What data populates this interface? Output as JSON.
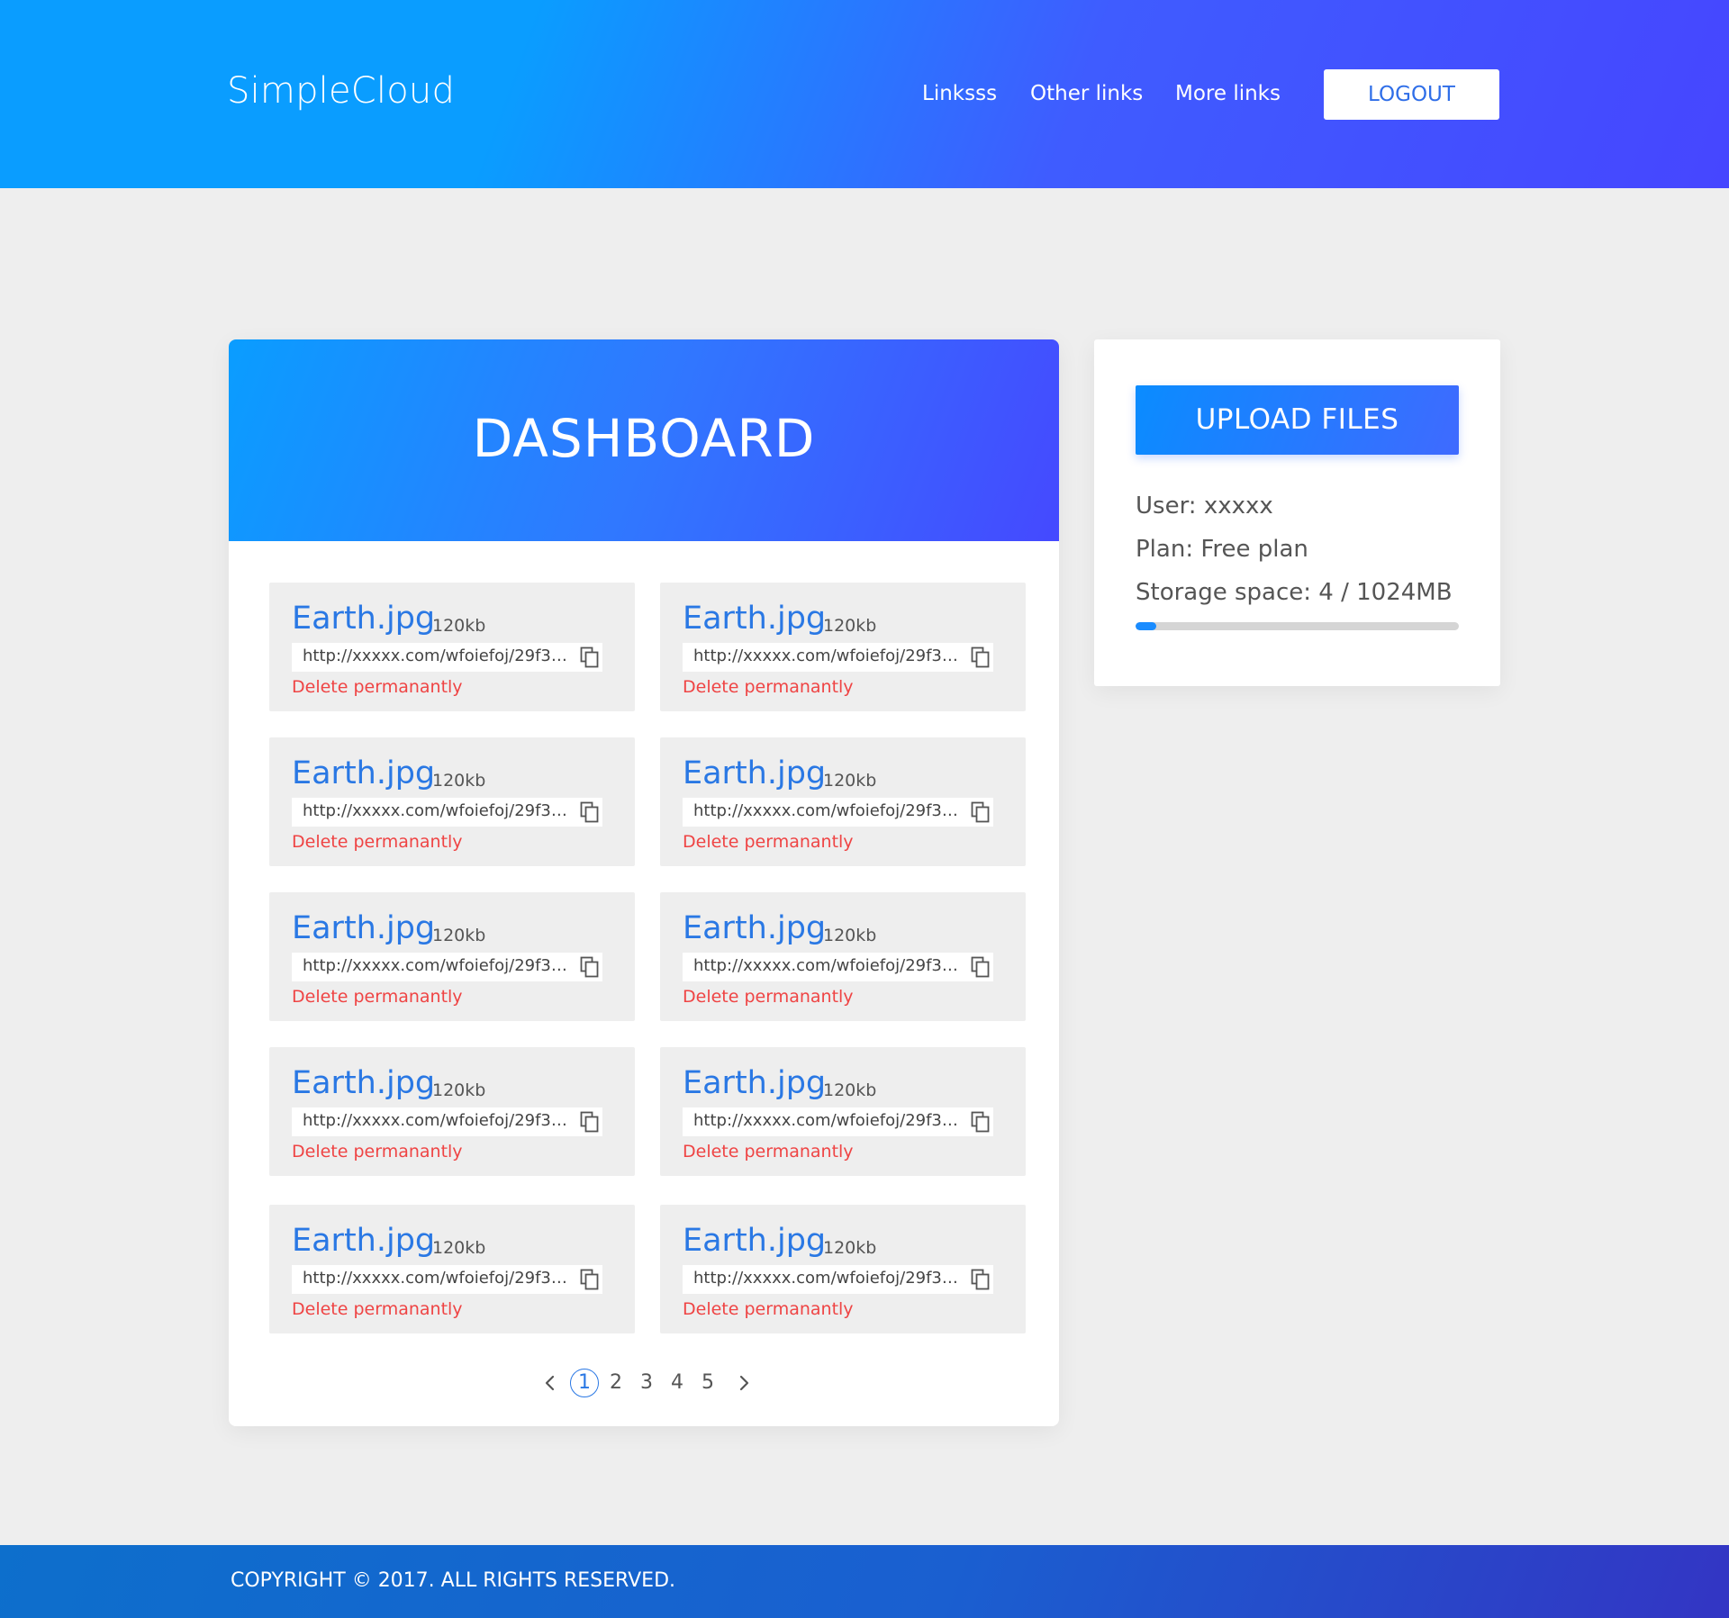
{
  "brand": {
    "logo": "SimpleCloud"
  },
  "nav": {
    "links": [
      "Linksss",
      "Other links",
      "More links"
    ],
    "logout_label": "LOGOUT"
  },
  "dashboard": {
    "title": "DASHBOARD",
    "files": [
      {
        "name": "Earth.jpg",
        "size": "120kb",
        "url": "http://xxxxx.com/wfoiefoj/29f34j...",
        "delete_label": "Delete permanantly"
      },
      {
        "name": "Earth.jpg",
        "size": "120kb",
        "url": "http://xxxxx.com/wfoiefoj/29f34j...",
        "delete_label": "Delete permanantly"
      },
      {
        "name": "Earth.jpg",
        "size": "120kb",
        "url": "http://xxxxx.com/wfoiefoj/29f34j...",
        "delete_label": "Delete permanantly"
      },
      {
        "name": "Earth.jpg",
        "size": "120kb",
        "url": "http://xxxxx.com/wfoiefoj/29f34j...",
        "delete_label": "Delete permanantly"
      },
      {
        "name": "Earth.jpg",
        "size": "120kb",
        "url": "http://xxxxx.com/wfoiefoj/29f34j...",
        "delete_label": "Delete permanantly"
      },
      {
        "name": "Earth.jpg",
        "size": "120kb",
        "url": "http://xxxxx.com/wfoiefoj/29f34j...",
        "delete_label": "Delete permanantly"
      },
      {
        "name": "Earth.jpg",
        "size": "120kb",
        "url": "http://xxxxx.com/wfoiefoj/29f34j...",
        "delete_label": "Delete permanantly"
      },
      {
        "name": "Earth.jpg",
        "size": "120kb",
        "url": "http://xxxxx.com/wfoiefoj/29f34j...",
        "delete_label": "Delete permanantly"
      },
      {
        "name": "Earth.jpg",
        "size": "120kb",
        "url": "http://xxxxx.com/wfoiefoj/29f34j...",
        "delete_label": "Delete permanantly"
      },
      {
        "name": "Earth.jpg",
        "size": "120kb",
        "url": "http://xxxxx.com/wfoiefoj/29f34j...",
        "delete_label": "Delete permanantly"
      }
    ],
    "pagination": {
      "pages": [
        "1",
        "2",
        "3",
        "4",
        "5"
      ],
      "current": "1",
      "prev_icon": "chevron-left-icon",
      "next_icon": "chevron-right-icon"
    }
  },
  "sidebar": {
    "upload_label": "UPLOAD FILES",
    "user": "User: xxxxx",
    "plan": "Plan: Free plan",
    "storage": "Storage space: 4 / 1024MB",
    "storage_used_fraction": 0.065
  },
  "footer": {
    "copyright": "COPYRIGHT © 2017. ALL RIGHTS RESERVED."
  },
  "colors": {
    "accent": "#2a78e4",
    "gradient_start": "#0a9dff",
    "gradient_end": "#4646ff",
    "danger": "#ef4444",
    "background": "#eeeeee"
  }
}
